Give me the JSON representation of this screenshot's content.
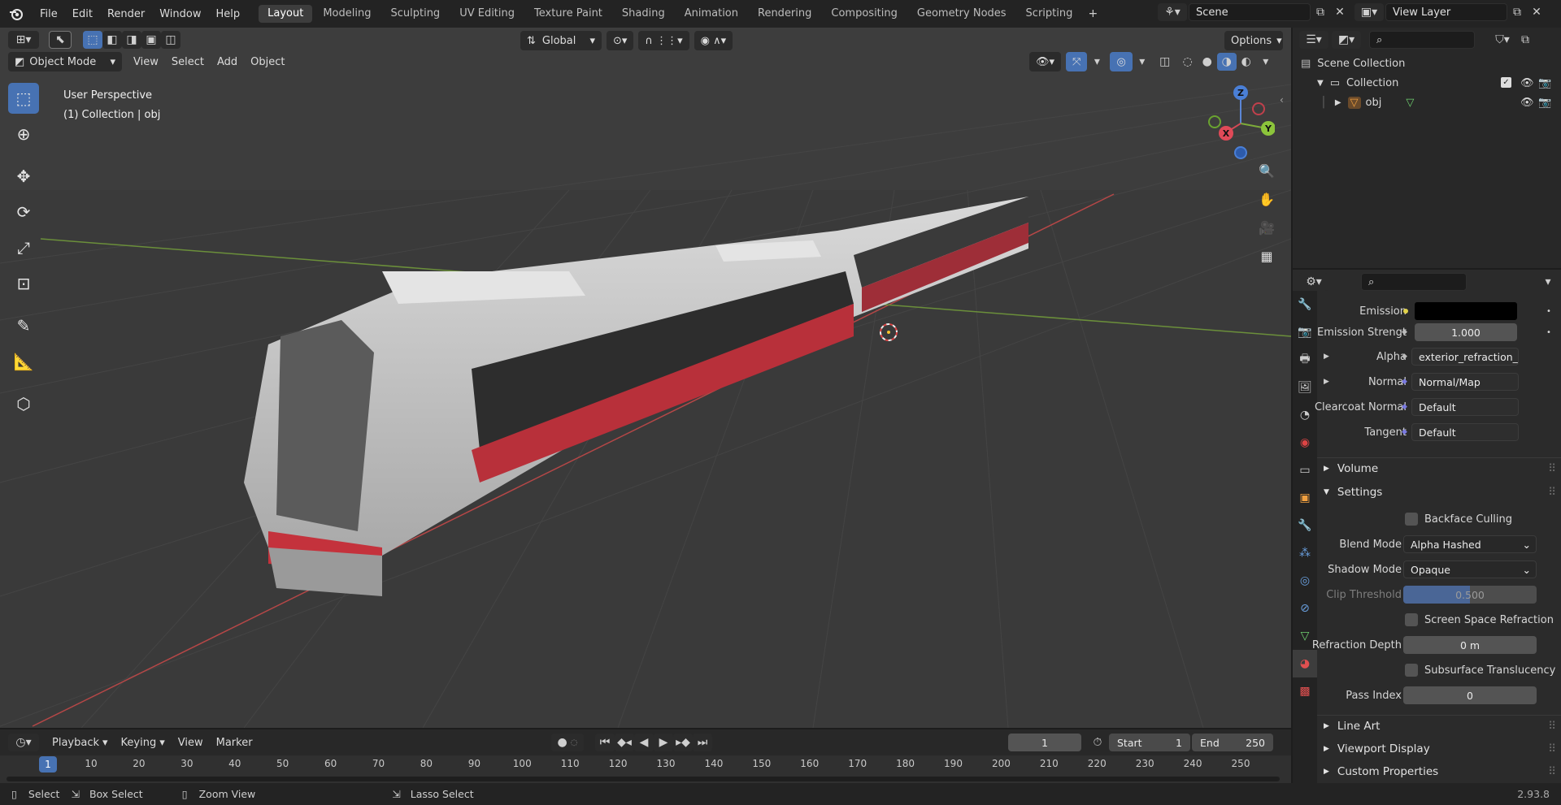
{
  "topbar": {
    "menus": [
      "File",
      "Edit",
      "Render",
      "Window",
      "Help"
    ],
    "workspaces": [
      "Layout",
      "Modeling",
      "Sculpting",
      "UV Editing",
      "Texture Paint",
      "Shading",
      "Animation",
      "Rendering",
      "Compositing",
      "Geometry Nodes",
      "Scripting"
    ],
    "active_workspace": "Layout",
    "scene_label": "Scene",
    "view_layer_label": "View Layer"
  },
  "viewport": {
    "transform_orientation": "Global",
    "options_label": "Options",
    "mode": "Object Mode",
    "menus": [
      "View",
      "Select",
      "Add",
      "Object"
    ],
    "overlay_title": "User Perspective",
    "overlay_subtitle": "(1) Collection | obj",
    "gizmo_axes": [
      "Z",
      "X",
      "Y"
    ]
  },
  "outliner": {
    "scene_collection": "Scene Collection",
    "collection": "Collection",
    "object": "obj"
  },
  "properties": {
    "rows": [
      {
        "label": "Emission",
        "value": "",
        "kind": "color",
        "color": "#000000",
        "dot": "#e1d24a"
      },
      {
        "label": "Emission Strengt",
        "value": "1.000",
        "kind": "number",
        "dot": "#a1a1a1"
      },
      {
        "label": "Alpha",
        "value": "exterior_refraction_i...",
        "kind": "socket",
        "dot": "#a1a1a1",
        "expand": true
      },
      {
        "label": "Normal",
        "value": "Normal/Map",
        "kind": "socket",
        "dot": "#6363c7",
        "expand": true
      },
      {
        "label": "Clearcoat Normal",
        "value": "Default",
        "kind": "socket",
        "dot": "#6363c7"
      },
      {
        "label": "Tangent",
        "value": "Default",
        "kind": "socket",
        "dot": "#6363c7"
      }
    ],
    "volume_panel": "Volume",
    "settings_panel": "Settings",
    "backface_culling": "Backface Culling",
    "blend_mode_label": "Blend Mode",
    "blend_mode_value": "Alpha Hashed",
    "shadow_mode_label": "Shadow Mode",
    "shadow_mode_value": "Opaque",
    "clip_threshold_label": "Clip Threshold",
    "clip_threshold_value": "0.500",
    "screen_space_refraction": "Screen Space Refraction",
    "refraction_depth_label": "Refraction Depth",
    "refraction_depth_value": "0 m",
    "subsurface_translucency": "Subsurface Translucency",
    "pass_index_label": "Pass Index",
    "pass_index_value": "0",
    "line_art_panel": "Line Art",
    "viewport_display_panel": "Viewport Display",
    "custom_properties_panel": "Custom Properties"
  },
  "timeline": {
    "menus": [
      "Playback",
      "Keying",
      "View",
      "Marker"
    ],
    "current_frame": "1",
    "start_label": "Start",
    "start_value": "1",
    "end_label": "End",
    "end_value": "250",
    "ticks": [
      "1",
      "10",
      "20",
      "30",
      "40",
      "50",
      "60",
      "70",
      "80",
      "90",
      "100",
      "110",
      "120",
      "130",
      "140",
      "150",
      "160",
      "170",
      "180",
      "190",
      "200",
      "210",
      "220",
      "230",
      "240",
      "250"
    ]
  },
  "statusbar": {
    "select": "Select",
    "box_select": "Box Select",
    "zoom_view": "Zoom View",
    "lasso_select": "Lasso Select",
    "version": "2.93.8"
  }
}
